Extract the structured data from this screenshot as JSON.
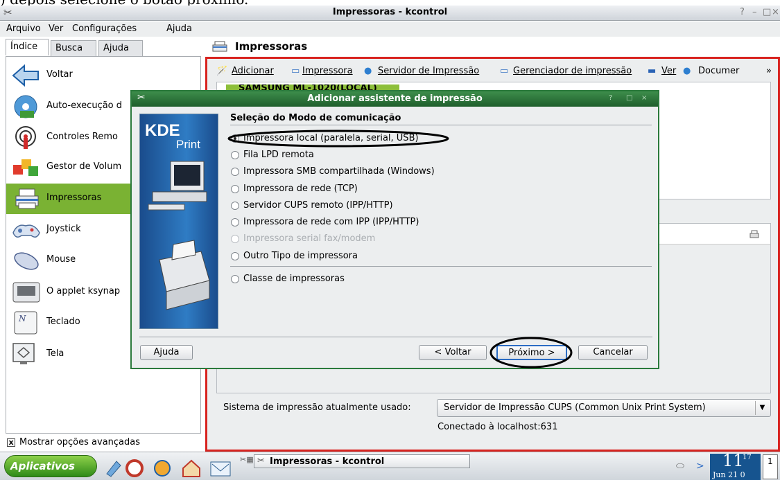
{
  "caption": ") depois selecione o botão próximo.",
  "window": {
    "title": "Impressoras - kcontrol"
  },
  "menubar": [
    "Arquivo",
    "Ver",
    "Configurações",
    "Ajuda"
  ],
  "tabs": [
    "Índice",
    "Busca",
    "Ajuda"
  ],
  "sidebar": {
    "items": [
      {
        "label": "Voltar",
        "icon": "back-arrow-icon"
      },
      {
        "label": "Auto-execução d",
        "icon": "autorun-icon"
      },
      {
        "label": "Controles Remo",
        "icon": "remote-control-icon"
      },
      {
        "label": "Gestor de Volum",
        "icon": "volume-manager-icon"
      },
      {
        "label": "Impressoras",
        "icon": "printer-icon"
      },
      {
        "label": "Joystick",
        "icon": "joystick-icon"
      },
      {
        "label": "Mouse",
        "icon": "mouse-icon"
      },
      {
        "label": "O applet ksynap",
        "icon": "touchpad-icon"
      },
      {
        "label": "Teclado",
        "icon": "keyboard-icon"
      },
      {
        "label": "Tela",
        "icon": "display-icon"
      }
    ],
    "advanced": "Mostrar opções avançadas",
    "advanced_mark": "x"
  },
  "panel": {
    "title": "Impressoras",
    "toolbar": [
      "Adicionar",
      "Impressora",
      "Servidor de Impressão",
      "Gerenciador de impressão",
      "Ver",
      "Documer",
      "»"
    ],
    "printer": "SAMSUNG ML-1020(LOCAL)",
    "system_label": "Sistema de impressão atualmente usado:",
    "system_value": "Servidor de Impressão CUPS (Common Unix Print System)",
    "connected": "Conectado à localhost:631"
  },
  "dialog": {
    "title": "Adicionar assistente de impressão",
    "logo_main": "KDE",
    "logo_sub": "Print",
    "section": "Seleção do Modo de comunicação",
    "options": [
      "Impressora local (paralela, serial, USB)",
      "Fila LPD remota",
      "Impressora SMB compartilhada (Windows)",
      "Impressora de rede (TCP)",
      "Servidor CUPS remoto (IPP/HTTP)",
      "Impressora de rede com IPP (IPP/HTTP)",
      "Impressora serial fax/modem",
      "Outro Tipo de impressora",
      "Classe de impressoras"
    ],
    "buttons": {
      "help": "Ajuda",
      "back": "< Voltar",
      "next": "Próximo >",
      "cancel": "Cancelar"
    }
  },
  "taskbar": {
    "start": "Aplicativos",
    "task": "Impressoras - kcontrol",
    "clock_hour": "11",
    "clock_min": "17",
    "clock_date": "Jun 21 0",
    "pager": "1"
  },
  "colors": {
    "accent_green": "#7ab233",
    "frame_red": "#d8231f",
    "dialog_title": "#2b7a3c",
    "kde_blue": "#2f7cc4"
  }
}
